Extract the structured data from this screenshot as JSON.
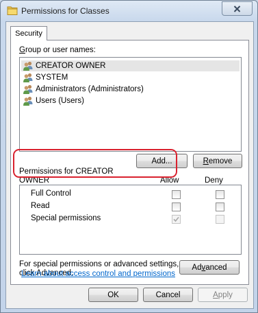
{
  "window": {
    "title": "Permissions for Classes",
    "close_glyph": "✕"
  },
  "tabs": [
    {
      "label": "Security"
    }
  ],
  "group_list": {
    "label": "Group or user names:",
    "items": [
      {
        "name": "CREATOR OWNER",
        "icon": "user-group-icon",
        "selected": true
      },
      {
        "name": "SYSTEM",
        "icon": "user-group-icon",
        "selected": false
      },
      {
        "name": "Administrators (Administrators)",
        "icon": "user-group-icon",
        "selected": false
      },
      {
        "name": "Users (Users)",
        "icon": "user-group-icon",
        "selected": false
      }
    ]
  },
  "group_buttons": {
    "add": "Add...",
    "remove": "Remove"
  },
  "permissions": {
    "label_line1": "Permissions for CREATOR",
    "label_line2": "OWNER",
    "col_allow": "Allow",
    "col_deny": "Deny",
    "rows": [
      {
        "name": "Full Control",
        "allow": false,
        "deny": false,
        "allow_enabled": true,
        "deny_enabled": true
      },
      {
        "name": "Read",
        "allow": false,
        "deny": false,
        "allow_enabled": true,
        "deny_enabled": true
      },
      {
        "name": "Special permissions",
        "allow": true,
        "deny": false,
        "allow_enabled": false,
        "deny_enabled": false
      }
    ]
  },
  "advanced": {
    "text_line1": "For special permissions or advanced settings,",
    "text_line2": "click Advanced.",
    "button": "Advanced"
  },
  "learn_link": "Learn about access control and permissions",
  "dialog_buttons": {
    "ok": "OK",
    "cancel": "Cancel",
    "apply": "Apply"
  },
  "colors": {
    "highlight": "#d9212e",
    "link": "#0066cc",
    "selection": "#e5e5e5"
  }
}
